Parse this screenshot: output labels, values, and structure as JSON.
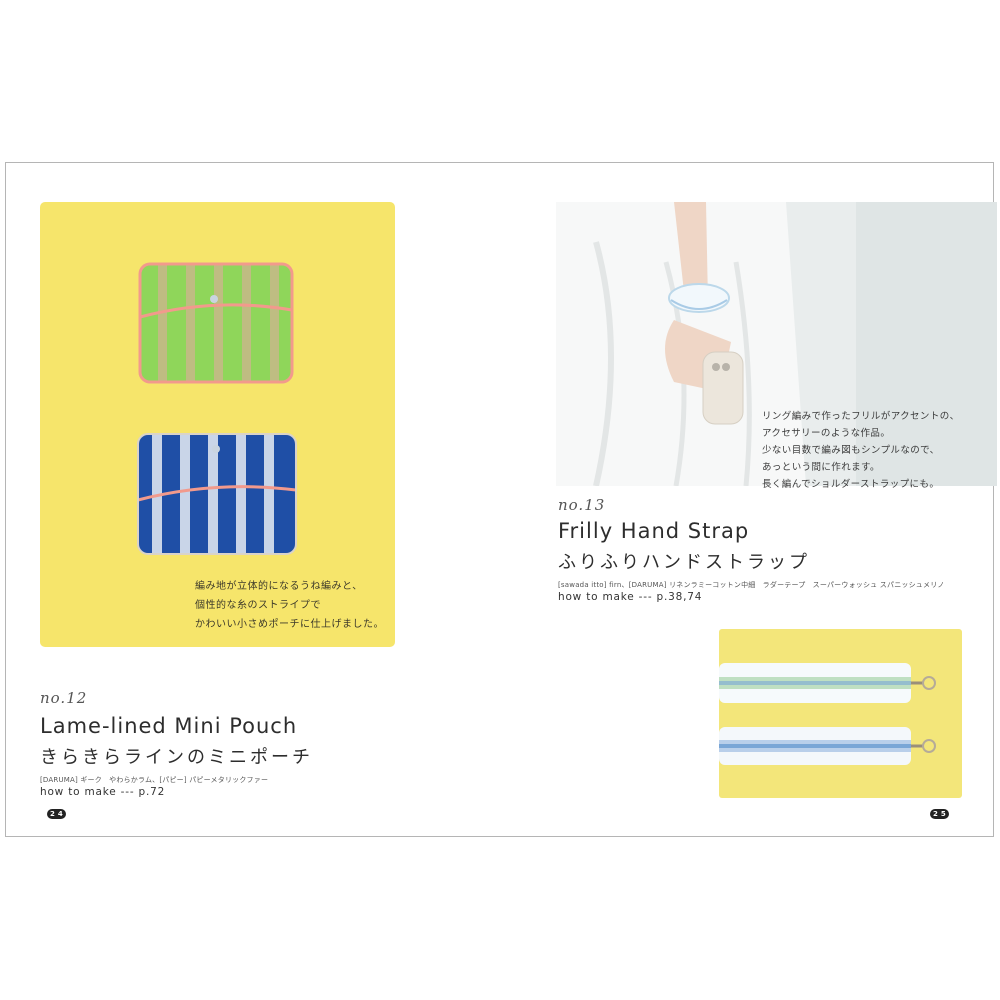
{
  "left_page": {
    "caption_lines": [
      "編み地が立体的になるうね編みと、",
      "個性的な糸のストライプで",
      "かわいい小さめポーチに仕上げました。"
    ],
    "number_label": "no.12",
    "title_en": "Lame-lined Mini Pouch",
    "title_jp": "きらきらラインのミニポーチ",
    "materials": "[DARUMA] ギーク　やわらかラム、[パピー] パピーメタリックファー",
    "how_to_make": "how to make --- p.72",
    "page_digits": [
      "2",
      "4"
    ]
  },
  "right_page": {
    "caption_lines": [
      "リング編みで作ったフリルがアクセントの、",
      "アクセサリーのような作品。",
      "少ない目数で編み図もシンプルなので、",
      "あっという間に作れます。",
      "長く編んでショルダーストラップにも。"
    ],
    "number_label": "no.13",
    "title_en": "Frilly Hand Strap",
    "title_jp": "ふりふりハンドストラップ",
    "materials": "[sawada itto] firn、[DARUMA] リネンラミーコットン中細　ラダーテープ　スーパーウォッシュ スパニッシュメリノ",
    "how_to_make": "how to make --- p.38,74",
    "page_digits": [
      "2",
      "5"
    ]
  },
  "colors": {
    "yellow_bg": "#f6e56b",
    "pouch_green": "#8fd65a",
    "pouch_blue": "#1f4fa6",
    "pouch_trim_pink": "#f29a8c",
    "strap_white": "#f4f8fb",
    "strap_blue": "#7aa6d6"
  }
}
